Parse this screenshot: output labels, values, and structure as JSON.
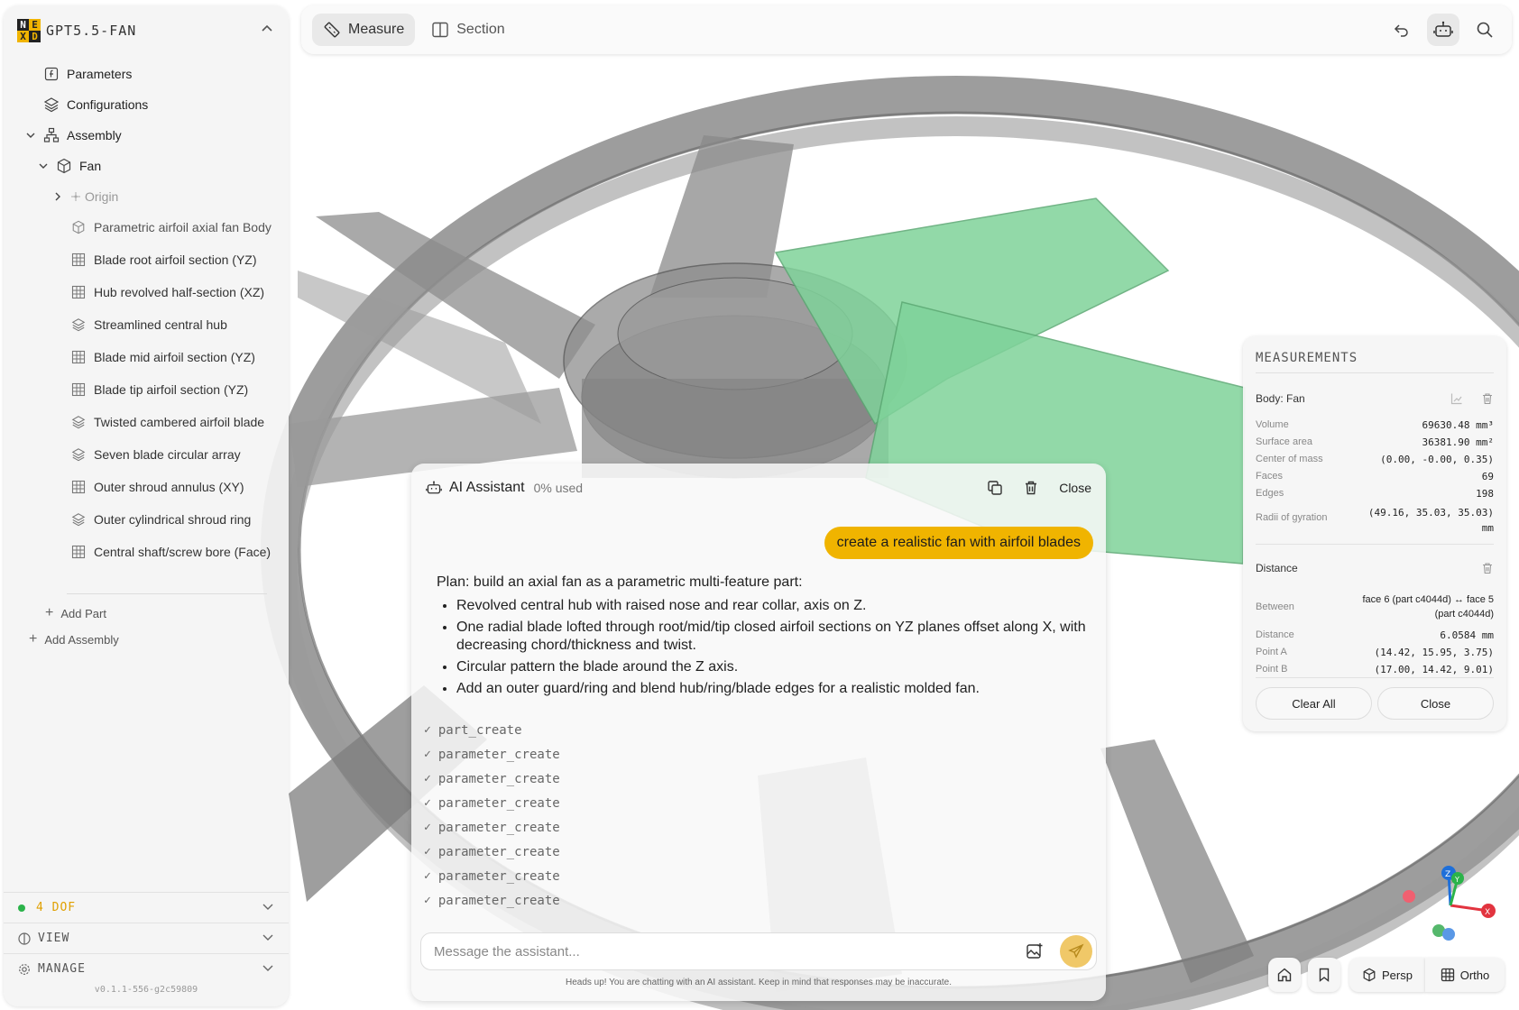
{
  "project": {
    "name": "GPT5.5-FAN",
    "logo_letters": [
      "N",
      "E",
      "X",
      "D"
    ]
  },
  "tree": {
    "parameters": "Parameters",
    "configurations": "Configurations",
    "assembly": "Assembly",
    "fan": "Fan",
    "origin": "Origin",
    "features": [
      {
        "label": "Parametric airfoil axial fan Body",
        "icon": "box-icon"
      },
      {
        "label": "Blade root airfoil section (YZ)",
        "icon": "sketch-grid-icon"
      },
      {
        "label": "Hub revolved half-section (XZ)",
        "icon": "sketch-grid-icon"
      },
      {
        "label": "Streamlined central hub",
        "icon": "layers-icon"
      },
      {
        "label": "Blade mid airfoil section (YZ)",
        "icon": "sketch-grid-icon"
      },
      {
        "label": "Blade tip airfoil section (YZ)",
        "icon": "sketch-grid-icon"
      },
      {
        "label": "Twisted cambered airfoil blade",
        "icon": "layers-icon"
      },
      {
        "label": "Seven blade circular array",
        "icon": "layers-icon"
      },
      {
        "label": "Outer shroud annulus (XY)",
        "icon": "sketch-grid-icon"
      },
      {
        "label": "Outer cylindrical shroud ring",
        "icon": "layers-icon"
      },
      {
        "label": "Central shaft/screw bore (Face)",
        "icon": "sketch-grid-icon"
      }
    ],
    "add_part": "Add Part",
    "add_assembly": "Add Assembly"
  },
  "footer": {
    "dof": "4 DOF",
    "view": "VIEW",
    "manage": "MANAGE",
    "version": "v0.1.1-556-g2c59809"
  },
  "toolbar": {
    "measure": "Measure",
    "section": "Section"
  },
  "measurements": {
    "title": "MEASUREMENTS",
    "body_label": "Body: Fan",
    "rows": [
      {
        "label": "Volume",
        "value": "69630.48 mm³"
      },
      {
        "label": "Surface area",
        "value": "36381.90 mm²"
      },
      {
        "label": "Center of mass",
        "value": "(0.00, -0.00, 0.35)"
      },
      {
        "label": "Faces",
        "value": "69"
      },
      {
        "label": "Edges",
        "value": "198"
      },
      {
        "label": "Radii of gyration",
        "value": "(49.16, 35.03, 35.03)",
        "value2": "mm"
      }
    ],
    "distance_label": "Distance",
    "between_label": "Between",
    "between_value": "face 6 (part c4044d) ↔ face 5",
    "between_value2": "(part c4044d)",
    "distance_rows": [
      {
        "label": "Distance",
        "value": "6.0584 mm"
      },
      {
        "label": "Point A",
        "value": "(14.42, 15.95, 3.75)"
      },
      {
        "label": "Point B",
        "value": "(17.00, 14.42, 9.01)"
      }
    ],
    "clear_all": "Clear All",
    "close": "Close"
  },
  "chat": {
    "title": "AI Assistant",
    "usage": "0% used",
    "close": "Close",
    "user_message": "create a realistic fan with airfoil blades",
    "plan_intro": "Plan: build an axial fan as a parametric multi-feature part:",
    "plan_items": [
      "Revolved central hub with raised nose and rear collar, axis on Z.",
      "One radial blade lofted through root/mid/tip closed airfoil sections on YZ planes offset along X, with decreasing chord/thickness and twist.",
      "Circular pattern the blade around the Z axis.",
      "Add an outer guard/ring and blend hub/ring/blade edges for a realistic molded fan."
    ],
    "tool_calls": [
      "part_create",
      "parameter_create",
      "parameter_create",
      "parameter_create",
      "parameter_create",
      "parameter_create",
      "parameter_create",
      "parameter_create"
    ],
    "check": "✓",
    "placeholder": "Message the assistant...",
    "disclaimer": "Heads up! You are chatting with an AI assistant. Keep in mind that responses may be inaccurate."
  },
  "view_controls": {
    "persp": "Persp",
    "ortho": "Ortho"
  },
  "axes": {
    "x": "X",
    "y": "Y",
    "z": "Z"
  },
  "colors": {
    "accent": "#f0b400",
    "blade_highlight": "#7fd39a",
    "model_gray": "#8e8e8e",
    "dof_green": "#2bb34a",
    "dof_text": "#e0a000"
  }
}
